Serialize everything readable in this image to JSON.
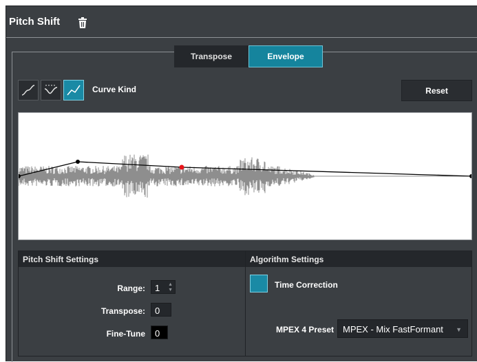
{
  "header": {
    "title": "Pitch Shift",
    "delete_icon": "trash-icon"
  },
  "tabs": [
    {
      "label": "Transpose",
      "active": false
    },
    {
      "label": "Envelope",
      "active": true
    }
  ],
  "curve_kind": {
    "label": "Curve Kind",
    "buttons": [
      {
        "icon": "curve-spline-icon",
        "active": false
      },
      {
        "icon": "curve-damped-spline-icon",
        "active": false
      },
      {
        "icon": "curve-linear-icon",
        "active": true
      }
    ]
  },
  "reset_label": "Reset",
  "pitch_shift_settings": {
    "heading": "Pitch Shift Settings",
    "range_label": "Range:",
    "range_value": "1",
    "transpose_label": "Transpose:",
    "transpose_value": "0",
    "finetune_label": "Fine-Tune",
    "finetune_value": "0"
  },
  "algorithm_settings": {
    "heading": "Algorithm Settings",
    "time_correction_label": "Time Correction",
    "time_correction_checked": true,
    "preset_label": "MPEX 4 Preset",
    "preset_value": "MPEX - Mix FastFormant"
  },
  "colors": {
    "accent": "#15849d",
    "panel": "#3b3f43",
    "dark": "#24272b",
    "waveform": "#8e8e8e",
    "selected_node": "#e8141a"
  }
}
